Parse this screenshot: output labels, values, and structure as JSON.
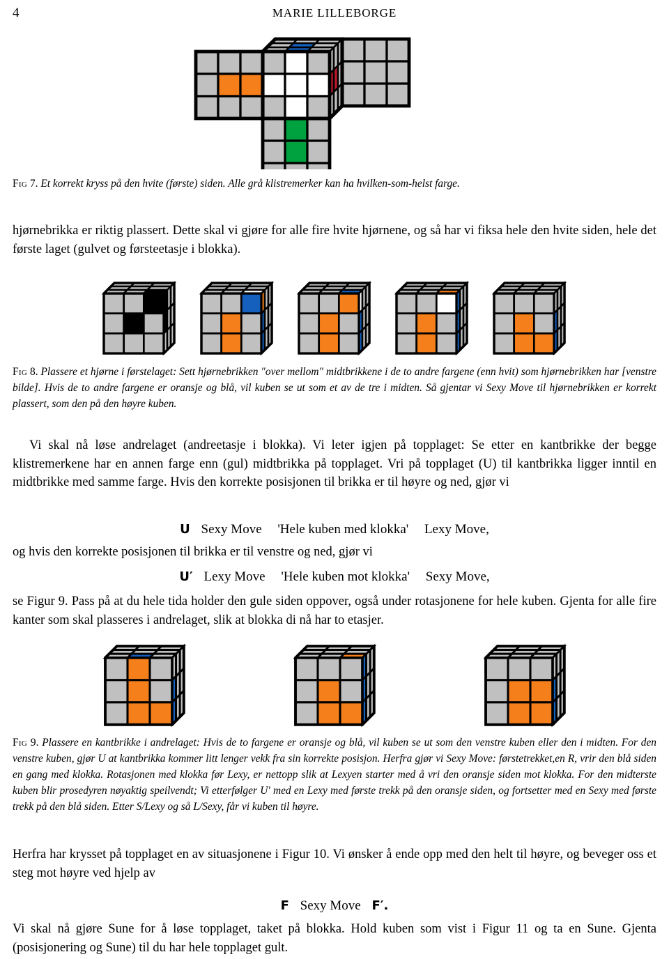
{
  "header": {
    "folio": "4",
    "running_title": "MARIE LILLEBORGE"
  },
  "figures": {
    "fig7": {
      "label": "Fig",
      "number": "7.",
      "caption": "Et korrekt kryss på den hvite (første) siden. Alle grå klistremerker kan ha hvilken-som-helst farge.",
      "description": "cross-net-diagram",
      "colors": {
        "grey": "#c0c0c0",
        "white": "#ffffff",
        "blue": "#1560bd",
        "red": "#c0182c",
        "orange": "#f57f1a",
        "green": "#00a23f",
        "outline": "#000000"
      }
    },
    "fig8": {
      "label": "Fig",
      "number": "8.",
      "caption": "Plassere et hjørne i førstelaget: Sett hjørnebrikken \"over mellom\" midtbrikkene i de to andre fargene (enn hvit) som hjørnebrikken har [venstre bilde]. Hvis de to andre fargene er oransje og blå, vil kuben se ut som et av de tre i midten. Så gjentar vi Sexy Move til hjørnebrikken er korrekt plassert, som den på den høyre kuben.",
      "cubes": [
        {
          "name": "cube-corner-target",
          "front": [
            [
              "grey",
              "grey",
              "black"
            ],
            [
              "grey",
              "black",
              "grey"
            ],
            [
              "grey",
              "grey",
              "grey"
            ]
          ],
          "right": [
            [
              "black",
              "grey",
              "grey"
            ],
            [
              "black",
              "grey",
              "grey"
            ],
            [
              "grey",
              "grey",
              "grey"
            ]
          ],
          "top": [
            [
              "grey",
              "grey",
              "grey"
            ],
            [
              "grey",
              "grey",
              "grey"
            ],
            [
              "grey",
              "grey",
              "black"
            ]
          ]
        },
        {
          "name": "cube-variant-1",
          "front": [
            [
              "grey",
              "grey",
              "blue"
            ],
            [
              "grey",
              "orange",
              "grey"
            ],
            [
              "grey",
              "orange",
              "grey"
            ]
          ],
          "right": [
            [
              "orange",
              "grey",
              "grey"
            ],
            [
              "blue",
              "grey",
              "grey"
            ],
            [
              "blue",
              "grey",
              "grey"
            ]
          ],
          "top": [
            [
              "grey",
              "grey",
              "grey"
            ],
            [
              "grey",
              "grey",
              "grey"
            ],
            [
              "grey",
              "grey",
              "white"
            ]
          ]
        },
        {
          "name": "cube-variant-2",
          "front": [
            [
              "grey",
              "grey",
              "orange"
            ],
            [
              "grey",
              "orange",
              "grey"
            ],
            [
              "grey",
              "orange",
              "grey"
            ]
          ],
          "right": [
            [
              "white",
              "grey",
              "grey"
            ],
            [
              "blue",
              "grey",
              "grey"
            ],
            [
              "blue",
              "grey",
              "grey"
            ]
          ],
          "top": [
            [
              "grey",
              "grey",
              "grey"
            ],
            [
              "grey",
              "grey",
              "grey"
            ],
            [
              "grey",
              "grey",
              "blue"
            ]
          ]
        },
        {
          "name": "cube-variant-3",
          "front": [
            [
              "grey",
              "grey",
              "white"
            ],
            [
              "grey",
              "orange",
              "grey"
            ],
            [
              "grey",
              "orange",
              "grey"
            ]
          ],
          "right": [
            [
              "blue",
              "grey",
              "grey"
            ],
            [
              "blue",
              "grey",
              "grey"
            ],
            [
              "blue",
              "grey",
              "grey"
            ]
          ],
          "top": [
            [
              "grey",
              "grey",
              "grey"
            ],
            [
              "grey",
              "grey",
              "grey"
            ],
            [
              "grey",
              "grey",
              "orange"
            ]
          ]
        },
        {
          "name": "cube-solved-corner",
          "front": [
            [
              "grey",
              "grey",
              "grey"
            ],
            [
              "grey",
              "orange",
              "grey"
            ],
            [
              "grey",
              "orange",
              "orange"
            ]
          ],
          "right": [
            [
              "grey",
              "grey",
              "grey"
            ],
            [
              "blue",
              "grey",
              "grey"
            ],
            [
              "blue",
              "grey",
              "grey"
            ]
          ],
          "top": [
            [
              "grey",
              "grey",
              "grey"
            ],
            [
              "grey",
              "grey",
              "grey"
            ],
            [
              "grey",
              "grey",
              "grey"
            ]
          ]
        }
      ]
    },
    "fig9": {
      "label": "Fig",
      "number": "9.",
      "caption": "Plassere en kantbrikke i andrelaget: Hvis de to fargene er oransje og blå, vil kuben se ut som den venstre kuben eller den i midten. For den venstre kuben, gjør U at kantbrikka kommer litt lenger vekk fra sin korrekte posisjon. Herfra gjør vi Sexy Move: førstetrekket,en R, vrir den blå siden en gang med klokka. Rotasjonen med klokka før Lexy, er nettopp slik at Lexyen starter med å vri den oransje siden mot klokka. For den midterste kuben blir prosedyren nøyaktig speilvendt; Vi etterfølger U' med en Lexy med første trekk på den oransje siden, og fortsetter med en Sexy med første trekk på den blå siden. Etter S/Lexy og så L/Sexy, får vi kuben til høyre.",
      "cubes": [
        {
          "name": "cube-edge-left",
          "front": [
            [
              "grey",
              "orange",
              "grey"
            ],
            [
              "grey",
              "orange",
              "grey"
            ],
            [
              "grey",
              "orange",
              "orange"
            ]
          ],
          "right": [
            [
              "grey",
              "grey",
              "grey"
            ],
            [
              "blue",
              "grey",
              "grey"
            ],
            [
              "blue",
              "grey",
              "grey"
            ]
          ],
          "top": [
            [
              "grey",
              "grey",
              "grey"
            ],
            [
              "grey",
              "grey",
              "grey"
            ],
            [
              "grey",
              "blue",
              "grey"
            ]
          ]
        },
        {
          "name": "cube-edge-middle",
          "front": [
            [
              "grey",
              "grey",
              "grey"
            ],
            [
              "grey",
              "orange",
              "grey"
            ],
            [
              "grey",
              "orange",
              "orange"
            ]
          ],
          "right": [
            [
              "blue",
              "grey",
              "grey"
            ],
            [
              "blue",
              "grey",
              "grey"
            ],
            [
              "blue",
              "grey",
              "grey"
            ]
          ],
          "top": [
            [
              "grey",
              "grey",
              "grey"
            ],
            [
              "grey",
              "grey",
              "grey"
            ],
            [
              "grey",
              "grey",
              "orange"
            ]
          ]
        },
        {
          "name": "cube-edge-right",
          "front": [
            [
              "grey",
              "grey",
              "grey"
            ],
            [
              "grey",
              "orange",
              "orange"
            ],
            [
              "grey",
              "orange",
              "orange"
            ]
          ],
          "right": [
            [
              "grey",
              "grey",
              "grey"
            ],
            [
              "blue",
              "grey",
              "grey"
            ],
            [
              "blue",
              "grey",
              "grey"
            ]
          ],
          "top": [
            [
              "grey",
              "grey",
              "grey"
            ],
            [
              "grey",
              "grey",
              "grey"
            ],
            [
              "grey",
              "grey",
              "grey"
            ]
          ]
        }
      ]
    }
  },
  "paragraphs": {
    "p1": "hjørnebrikka er riktig plassert. Dette skal vi gjøre for alle fire hvite hjørnene, og så har vi fiksa hele den hvite siden, hele det første laget (gulvet og førsteetasje i blokka).",
    "p2": "Vi skal nå løse andrelaget (andreetasje i blokka). Vi leter igjen på topplaget: Se etter en kantbrikke der begge klistremerkene har en annen farge enn (gul) midtbrikka på topplaget. Vri på topplaget (U) til kantbrikka ligger inntil en midtbrikke med samme farge. Hvis den korrekte posisjonen til brikka er til høyre og ned, gjør vi",
    "p3": "og hvis den korrekte posisjonen til brikka er til venstre og ned, gjør vi",
    "p4": "se Figur 9. Pass på at du hele tida holder den gule siden oppover, også under rotasjonene for hele kuben. Gjenta for alle fire kanter som skal plasseres i andrelaget, slik at blokka di nå har to etasjer.",
    "p5": "Herfra har krysset på topplaget en av situasjonene i Figur 10. Vi ønsker å ende opp med den helt til høyre, og beveger oss et steg mot høyre ved hjelp av",
    "p6": "Vi skal nå gjøre Sune for å løse topplaget, taket på blokka. Hold kuben som vist i Figur 11 og ta en Sune. Gjenta (posisjonering og Sune) til du har hele topplaget gult."
  },
  "formulas": {
    "f1": {
      "move1": "U",
      "name1": "Sexy Move",
      "rotation": "'Hele kuben med klokka'",
      "name2": "Lexy Move,"
    },
    "f2": {
      "move1": "U′",
      "name1": "Lexy Move",
      "rotation": "'Hele kuben mot klokka'",
      "name2": "Sexy Move,"
    },
    "f3": {
      "move1": "F",
      "name1": "Sexy Move",
      "move2": "F′."
    }
  },
  "palette": {
    "grey": "#c0c0c0",
    "white": "#ffffff",
    "black": "#000000",
    "blue": "#1560bd",
    "red": "#c0182c",
    "orange": "#f57f1a",
    "green": "#00a23f",
    "outline": "#000000",
    "page_bg": "#ffffff"
  }
}
